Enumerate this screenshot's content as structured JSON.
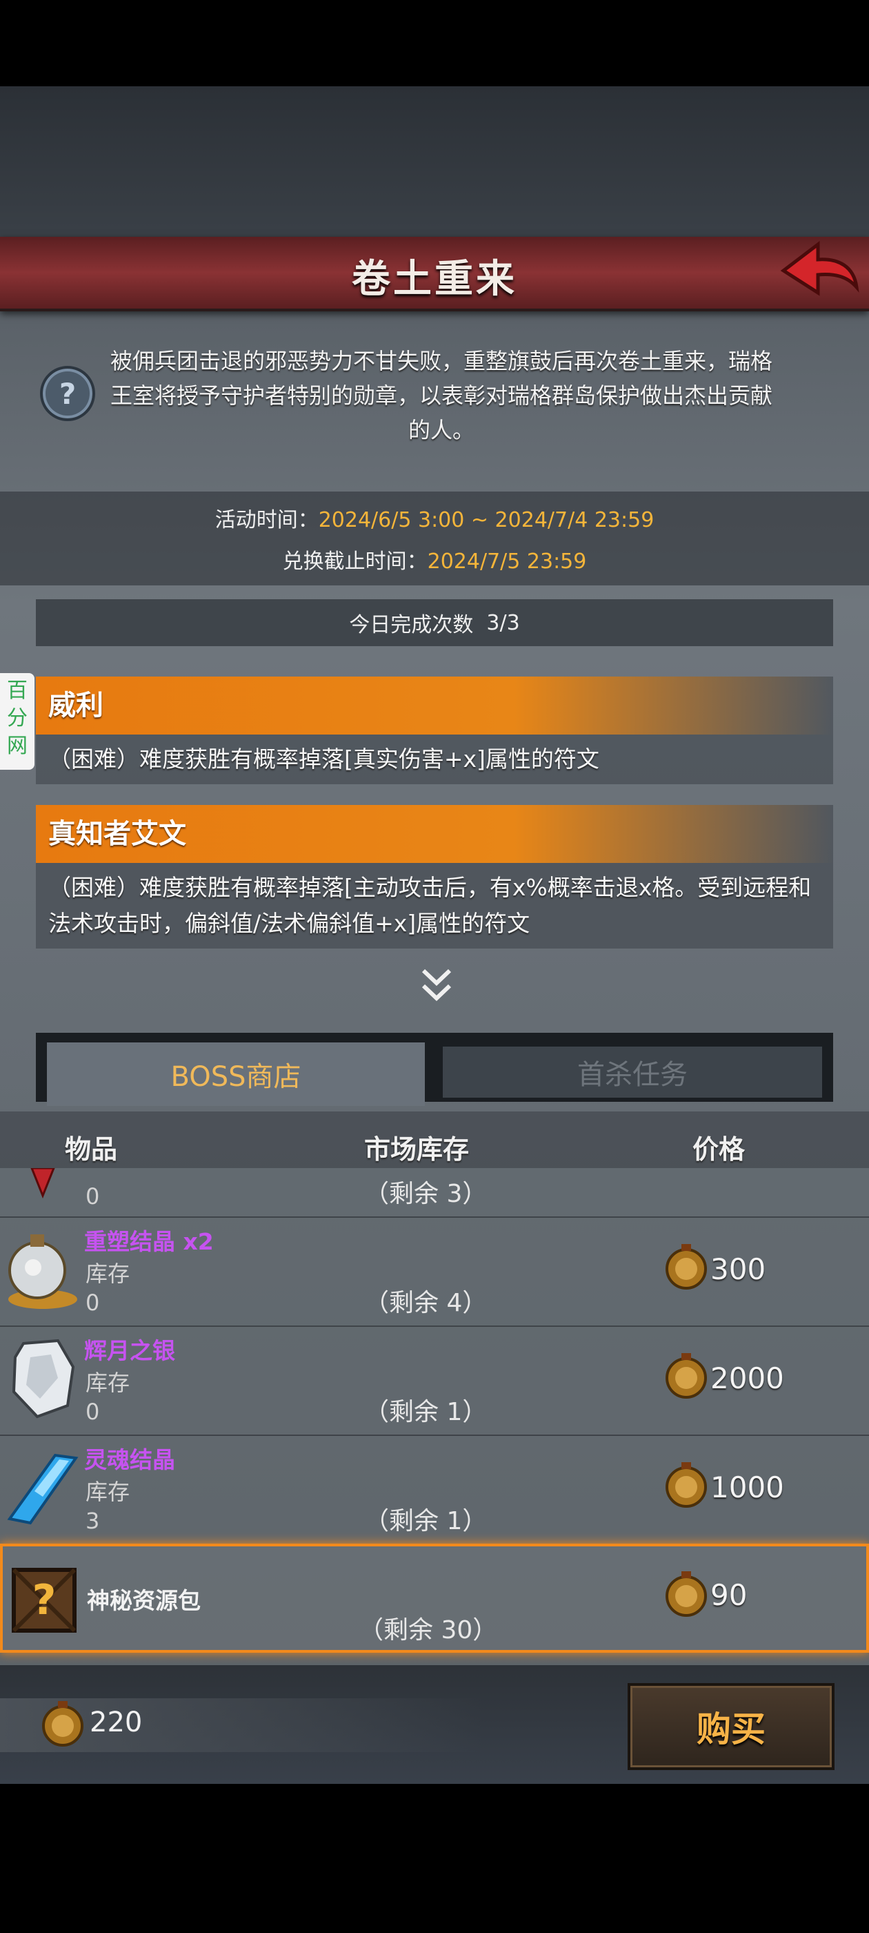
{
  "header": {
    "title": "卷土重来"
  },
  "description": "被佣兵团击退的邪恶势力不甘失败，重整旗鼓后再次卷土重来，瑞格王室将授予守护者特别的勋章，以表彰对瑞格群岛保护做出杰出贡献的人。",
  "times": {
    "activity_label": "活动时间：",
    "activity_value": "2024/6/5 3:00 ~ 2024/7/4 23:59",
    "exchange_label": "兑换截止时间：",
    "exchange_value": "2024/7/5 23:59"
  },
  "today": {
    "label": "今日完成次数",
    "value": "3/3"
  },
  "side_tag": "百分网",
  "bosses": [
    {
      "name": "威利",
      "desc": "（困难）难度获胜有概率掉落[真实伤害+x]属性的符文"
    },
    {
      "name": "真知者艾文",
      "desc": "（困难）难度获胜有概率掉落[主动攻击后，有x%概率击退x格。受到远程和法术攻击时，偏斜值/法术偏斜值+x]属性的符文"
    }
  ],
  "tabs": {
    "shop": "BOSS商店",
    "first_kill": "首杀任务"
  },
  "columns": {
    "item": "物品",
    "stock": "市场库存",
    "price": "价格"
  },
  "items": [
    {
      "name": "",
      "stock_label": "",
      "stock": "0",
      "remain": "（剩余 3）",
      "price": "",
      "icon": "partial-red-gem-icon"
    },
    {
      "name": "重塑结晶",
      "qty": "x2",
      "stock_label": "库存",
      "stock": "0",
      "remain": "（剩余 4）",
      "price": "300",
      "icon": "crystal-flask-icon"
    },
    {
      "name": "辉月之银",
      "qty": "",
      "stock_label": "库存",
      "stock": "0",
      "remain": "（剩余 1）",
      "price": "2000",
      "icon": "silver-ore-icon"
    },
    {
      "name": "灵魂结晶",
      "qty": "",
      "stock_label": "库存",
      "stock": "3",
      "remain": "（剩余 1）",
      "price": "1000",
      "icon": "blue-crystal-icon"
    },
    {
      "name": "神秘资源包",
      "qty": "",
      "stock_label": "",
      "stock": "",
      "remain": "（剩余 30）",
      "price": "90",
      "icon": "mystery-box-icon"
    }
  ],
  "currency": {
    "amount": "220"
  },
  "buy_button": "购买",
  "colors": {
    "accent_orange": "#e77a10",
    "title_red": "#8a3234",
    "rare_purple": "#c653f0",
    "price_gold": "#f5b53a"
  }
}
